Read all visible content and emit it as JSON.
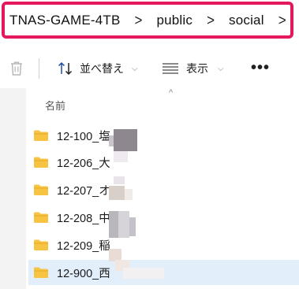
{
  "breadcrumb": {
    "items": [
      "TNAS-GAME-4TB",
      "public",
      "social"
    ],
    "separator": ">",
    "highlight_color": "#e3185f"
  },
  "toolbar": {
    "delete_icon": "trash-icon",
    "sort_label": "並べ替え",
    "sort_icon": "sort-arrows-icon",
    "view_label": "表示",
    "view_icon": "list-lines-icon",
    "more_label": "•••"
  },
  "file_list": {
    "column_name": "名前",
    "sort_indicator": "^",
    "items": [
      {
        "name": "12-100_塩"
      },
      {
        "name": "12-206_大"
      },
      {
        "name": "12-207_オ"
      },
      {
        "name": "12-208_中"
      },
      {
        "name": "12-209_稲"
      },
      {
        "name": "12-900_西"
      }
    ],
    "selected_index": 5,
    "folder_color": "#f6c343",
    "selection_color": "#e3eefb"
  }
}
